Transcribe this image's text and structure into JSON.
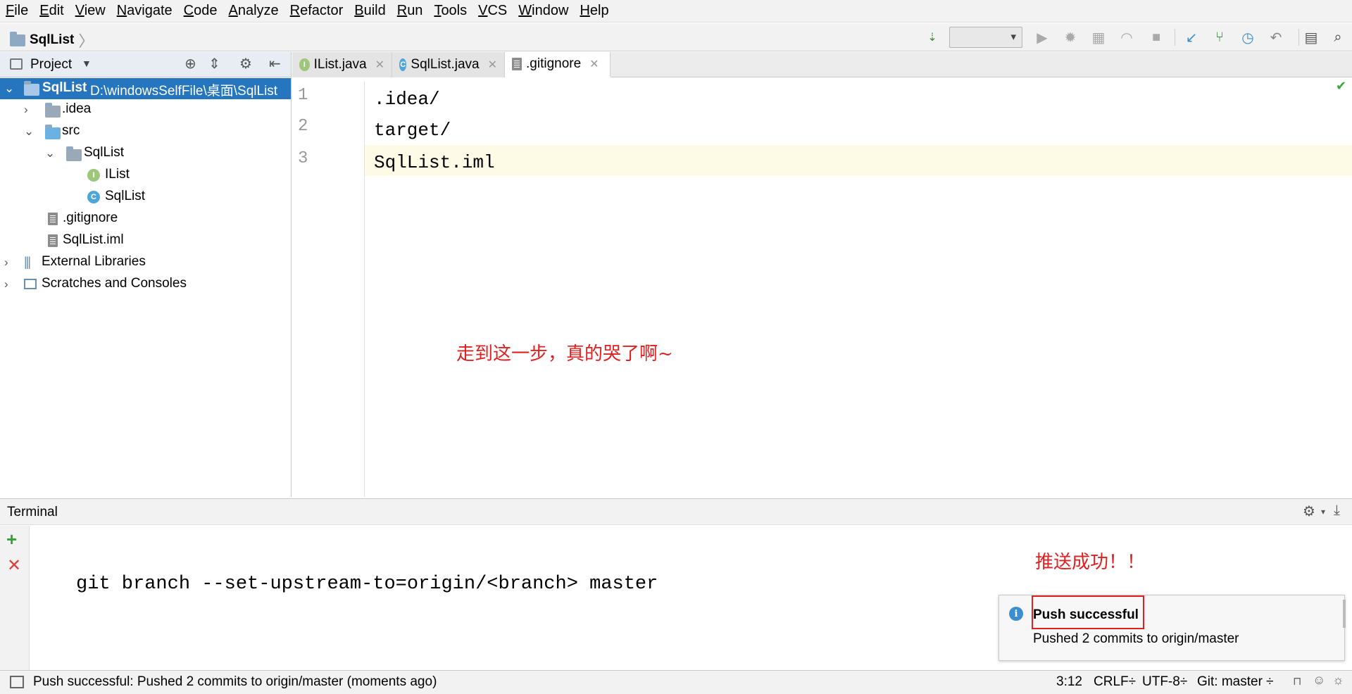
{
  "menu": [
    "File",
    "Edit",
    "View",
    "Navigate",
    "Code",
    "Analyze",
    "Refactor",
    "Build",
    "Run",
    "Tools",
    "VCS",
    "Window",
    "Help"
  ],
  "navbar": {
    "breadcrumb": "SqlList"
  },
  "project_panel": {
    "title": "Project",
    "tree": [
      {
        "label": "SqlList",
        "path": "D:\\windowsSelfFile\\桌面\\SqlList"
      },
      {
        "label": ".idea"
      },
      {
        "label": "src"
      },
      {
        "label": "SqlList"
      },
      {
        "label": "IList",
        "badge": "I"
      },
      {
        "label": "SqlList",
        "badge": "C"
      },
      {
        "label": ".gitignore"
      },
      {
        "label": "SqlList.iml"
      },
      {
        "label": "External Libraries"
      },
      {
        "label": "Scratches and Consoles"
      }
    ]
  },
  "tabs": [
    {
      "label": "IList.java",
      "badge": "I"
    },
    {
      "label": "SqlList.java",
      "badge": "C"
    },
    {
      "label": ".gitignore",
      "active": true
    }
  ],
  "editor": {
    "line_numbers": [
      "1",
      "2",
      "3"
    ],
    "lines": [
      ".idea/",
      "target/",
      "SqlList.iml"
    ],
    "annotation": "走到这一步，真的哭了啊~"
  },
  "terminal": {
    "title": "Terminal",
    "command": "git branch --set-upstream-to=origin/<branch> master",
    "annotation": "推送成功！！"
  },
  "notification": {
    "title": "Push successful",
    "body": "Pushed 2 commits to origin/master"
  },
  "statusbar": {
    "message": "Push successful: Pushed 2 commits to origin/master (moments ago)",
    "position": "3:12",
    "line_separator": "CRLF÷",
    "encoding": "UTF-8÷",
    "git": "Git: master ÷"
  },
  "colors": {
    "selection": "#2675bf",
    "annotation": "#e02020",
    "current_line": "#fdfbe6"
  }
}
